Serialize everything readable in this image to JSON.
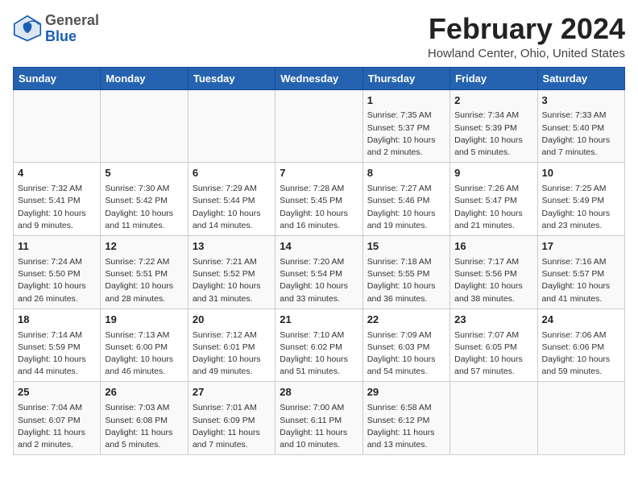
{
  "header": {
    "logo_general": "General",
    "logo_blue": "Blue",
    "month_year": "February 2024",
    "location": "Howland Center, Ohio, United States"
  },
  "columns": [
    "Sunday",
    "Monday",
    "Tuesday",
    "Wednesday",
    "Thursday",
    "Friday",
    "Saturday"
  ],
  "weeks": [
    [
      {
        "day": "",
        "content": ""
      },
      {
        "day": "",
        "content": ""
      },
      {
        "day": "",
        "content": ""
      },
      {
        "day": "",
        "content": ""
      },
      {
        "day": "1",
        "content": "Sunrise: 7:35 AM\nSunset: 5:37 PM\nDaylight: 10 hours\nand 2 minutes."
      },
      {
        "day": "2",
        "content": "Sunrise: 7:34 AM\nSunset: 5:39 PM\nDaylight: 10 hours\nand 5 minutes."
      },
      {
        "day": "3",
        "content": "Sunrise: 7:33 AM\nSunset: 5:40 PM\nDaylight: 10 hours\nand 7 minutes."
      }
    ],
    [
      {
        "day": "4",
        "content": "Sunrise: 7:32 AM\nSunset: 5:41 PM\nDaylight: 10 hours\nand 9 minutes."
      },
      {
        "day": "5",
        "content": "Sunrise: 7:30 AM\nSunset: 5:42 PM\nDaylight: 10 hours\nand 11 minutes."
      },
      {
        "day": "6",
        "content": "Sunrise: 7:29 AM\nSunset: 5:44 PM\nDaylight: 10 hours\nand 14 minutes."
      },
      {
        "day": "7",
        "content": "Sunrise: 7:28 AM\nSunset: 5:45 PM\nDaylight: 10 hours\nand 16 minutes."
      },
      {
        "day": "8",
        "content": "Sunrise: 7:27 AM\nSunset: 5:46 PM\nDaylight: 10 hours\nand 19 minutes."
      },
      {
        "day": "9",
        "content": "Sunrise: 7:26 AM\nSunset: 5:47 PM\nDaylight: 10 hours\nand 21 minutes."
      },
      {
        "day": "10",
        "content": "Sunrise: 7:25 AM\nSunset: 5:49 PM\nDaylight: 10 hours\nand 23 minutes."
      }
    ],
    [
      {
        "day": "11",
        "content": "Sunrise: 7:24 AM\nSunset: 5:50 PM\nDaylight: 10 hours\nand 26 minutes."
      },
      {
        "day": "12",
        "content": "Sunrise: 7:22 AM\nSunset: 5:51 PM\nDaylight: 10 hours\nand 28 minutes."
      },
      {
        "day": "13",
        "content": "Sunrise: 7:21 AM\nSunset: 5:52 PM\nDaylight: 10 hours\nand 31 minutes."
      },
      {
        "day": "14",
        "content": "Sunrise: 7:20 AM\nSunset: 5:54 PM\nDaylight: 10 hours\nand 33 minutes."
      },
      {
        "day": "15",
        "content": "Sunrise: 7:18 AM\nSunset: 5:55 PM\nDaylight: 10 hours\nand 36 minutes."
      },
      {
        "day": "16",
        "content": "Sunrise: 7:17 AM\nSunset: 5:56 PM\nDaylight: 10 hours\nand 38 minutes."
      },
      {
        "day": "17",
        "content": "Sunrise: 7:16 AM\nSunset: 5:57 PM\nDaylight: 10 hours\nand 41 minutes."
      }
    ],
    [
      {
        "day": "18",
        "content": "Sunrise: 7:14 AM\nSunset: 5:59 PM\nDaylight: 10 hours\nand 44 minutes."
      },
      {
        "day": "19",
        "content": "Sunrise: 7:13 AM\nSunset: 6:00 PM\nDaylight: 10 hours\nand 46 minutes."
      },
      {
        "day": "20",
        "content": "Sunrise: 7:12 AM\nSunset: 6:01 PM\nDaylight: 10 hours\nand 49 minutes."
      },
      {
        "day": "21",
        "content": "Sunrise: 7:10 AM\nSunset: 6:02 PM\nDaylight: 10 hours\nand 51 minutes."
      },
      {
        "day": "22",
        "content": "Sunrise: 7:09 AM\nSunset: 6:03 PM\nDaylight: 10 hours\nand 54 minutes."
      },
      {
        "day": "23",
        "content": "Sunrise: 7:07 AM\nSunset: 6:05 PM\nDaylight: 10 hours\nand 57 minutes."
      },
      {
        "day": "24",
        "content": "Sunrise: 7:06 AM\nSunset: 6:06 PM\nDaylight: 10 hours\nand 59 minutes."
      }
    ],
    [
      {
        "day": "25",
        "content": "Sunrise: 7:04 AM\nSunset: 6:07 PM\nDaylight: 11 hours\nand 2 minutes."
      },
      {
        "day": "26",
        "content": "Sunrise: 7:03 AM\nSunset: 6:08 PM\nDaylight: 11 hours\nand 5 minutes."
      },
      {
        "day": "27",
        "content": "Sunrise: 7:01 AM\nSunset: 6:09 PM\nDaylight: 11 hours\nand 7 minutes."
      },
      {
        "day": "28",
        "content": "Sunrise: 7:00 AM\nSunset: 6:11 PM\nDaylight: 11 hours\nand 10 minutes."
      },
      {
        "day": "29",
        "content": "Sunrise: 6:58 AM\nSunset: 6:12 PM\nDaylight: 11 hours\nand 13 minutes."
      },
      {
        "day": "",
        "content": ""
      },
      {
        "day": "",
        "content": ""
      }
    ]
  ]
}
